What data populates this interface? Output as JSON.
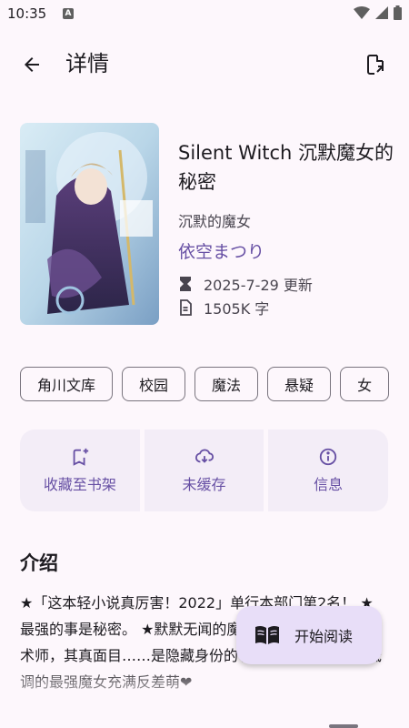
{
  "status": {
    "time": "10:35",
    "notif_letter": "A"
  },
  "appbar": {
    "title": "详情"
  },
  "book": {
    "title": "Silent Witch 沉默魔女的秘密",
    "subtitle": "沉默的魔女",
    "author": "依空まつり",
    "updated": "2025-7-29 更新",
    "words": "1505K 字"
  },
  "tags": [
    "角川文库",
    "校园",
    "魔法",
    "悬疑",
    "女"
  ],
  "actions": {
    "favorite": "收藏至书架",
    "cache": "未缓存",
    "info": "信息"
  },
  "intro": {
    "heading": "介绍",
    "text": "★「这本轻小说真厉害！2022」单行本部门第2名！ ★最强的事是秘密。 ★默默无闻的魔女，仅有的无咏唱魔术师，其真面目……是隐藏身份的学生!?社交恐惧症!?低调的最强魔女充满反差萌❤"
  },
  "fab": {
    "label": "开始阅读"
  }
}
